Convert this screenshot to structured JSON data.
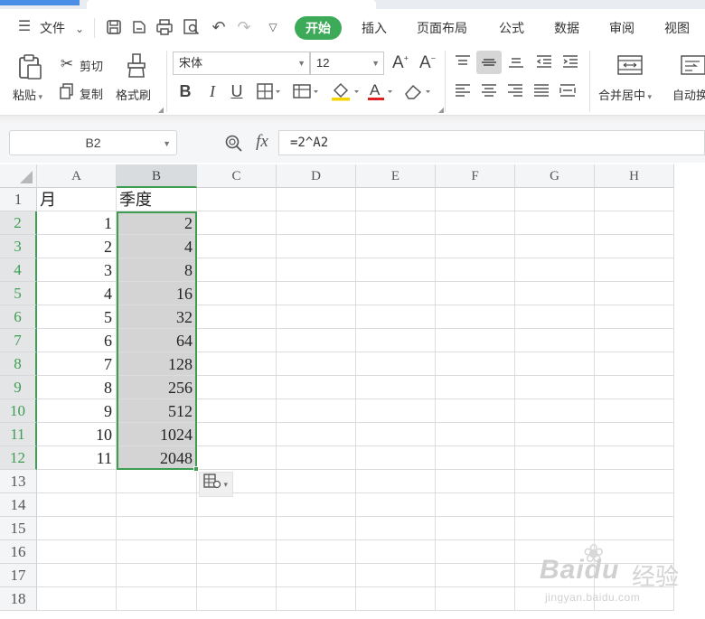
{
  "menubar": {
    "file_label": "文件",
    "tabs": [
      "开始",
      "插入",
      "页面布局",
      "公式",
      "数据",
      "审阅",
      "视图"
    ],
    "active_tab": "开始"
  },
  "ribbon": {
    "paste_label": "粘贴",
    "cut_label": "剪切",
    "copy_label": "复制",
    "format_painter_label": "格式刷",
    "font_name": "宋体",
    "font_size": "12",
    "merge_center_label": "合并居中",
    "auto_wrap_label": "自动换"
  },
  "formula_bar": {
    "name_box": "B2",
    "fx_label": "fx",
    "formula": "=2^A2"
  },
  "sheet": {
    "columns": [
      "A",
      "B",
      "C",
      "D",
      "E",
      "F",
      "G",
      "H"
    ],
    "rows": [
      "1",
      "2",
      "3",
      "4",
      "5",
      "6",
      "7",
      "8",
      "9",
      "10",
      "11",
      "12",
      "13",
      "14",
      "15",
      "16",
      "17",
      "18"
    ],
    "header": {
      "A": "月",
      "B": "季度"
    },
    "data": [
      {
        "A": "1",
        "B": "2"
      },
      {
        "A": "2",
        "B": "4"
      },
      {
        "A": "3",
        "B": "8"
      },
      {
        "A": "4",
        "B": "16"
      },
      {
        "A": "5",
        "B": "32"
      },
      {
        "A": "6",
        "B": "64"
      },
      {
        "A": "7",
        "B": "128"
      },
      {
        "A": "8",
        "B": "256"
      },
      {
        "A": "9",
        "B": "512"
      },
      {
        "A": "10",
        "B": "1024"
      },
      {
        "A": "11",
        "B": "2048"
      }
    ],
    "selection": "B2:B12"
  },
  "watermark": {
    "brand": "Baidu",
    "brand_cn": "经验",
    "url": "jingyan.baidu.com"
  },
  "colors": {
    "accent_green": "#3daa5a",
    "selection_border": "#3f9d52",
    "selected_fill": "#d4d4d4"
  }
}
